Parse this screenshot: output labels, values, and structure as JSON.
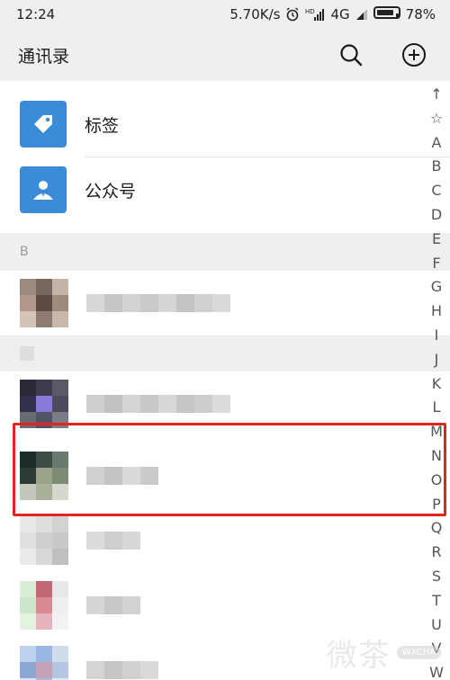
{
  "status_bar": {
    "time": "12:24",
    "net_speed": "5.70K/s",
    "network": "4G",
    "battery": "78%",
    "icons": [
      "alarm-icon",
      "hd-signal-icon",
      "signal-icon",
      "battery-icon"
    ]
  },
  "header": {
    "title": "通讯录",
    "icons": [
      "search-icon",
      "add-icon"
    ]
  },
  "special_items": [
    {
      "label": "标签",
      "icon": "tag-icon"
    },
    {
      "label": "公众号",
      "icon": "official-account-icon"
    }
  ],
  "section_letter": "B",
  "index_bar": [
    "↑",
    "☆",
    "A",
    "B",
    "C",
    "D",
    "E",
    "F",
    "G",
    "H",
    "I",
    "J",
    "K",
    "L",
    "M",
    "N",
    "O",
    "P",
    "Q",
    "R",
    "S",
    "T",
    "U",
    "V",
    "W"
  ],
  "watermark": {
    "cn": "微茶",
    "en": "WXCHA"
  },
  "colors": {
    "accent_blue": "#3a8bd8",
    "highlight_red": "#e3251f",
    "bar_bg": "#efefef"
  }
}
